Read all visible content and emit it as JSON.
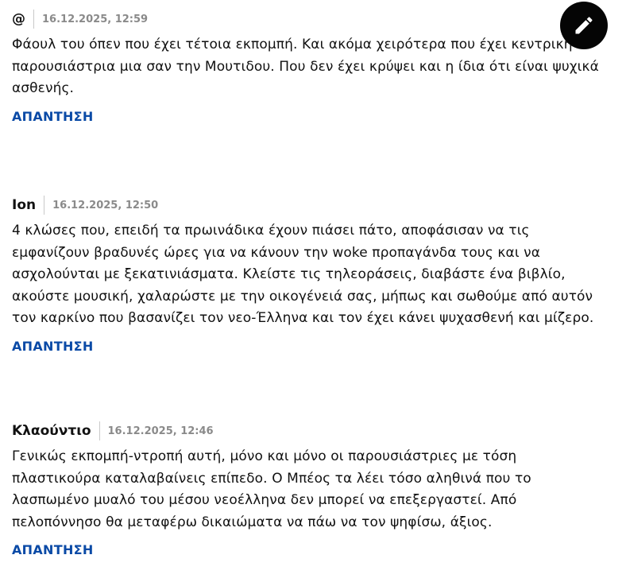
{
  "comments": [
    {
      "author": "@",
      "date": "16.12.2025, 12:59",
      "text": "Φάουλ του όπεν που έχει τέτοια εκπομπή. Και ακόμα χειρότερα που έχει κεντρική παρουσιάστρια μια σαν την Μουτιδου. Που δεν έχει κρύψει και η ίδια ότι είναι ψυχικά ασθενής.",
      "reply_label": "ΑΠΑΝΤΗΣΗ"
    },
    {
      "author": "Ion",
      "date": "16.12.2025, 12:50",
      "text": "4 κλώσες που, επειδή τα πρωινάδικα έχουν πιάσει πάτο, αποφάσισαν να τις εμφανίζουν βραδυνές ώρες για να κάνουν την woke προπαγάνδα τους και να ασχολούνται με ξεκατινιάσματα. Κλείστε τις τηλεοράσεις, διαβάστε ένα βιβλίο, ακούστε μουσική, χαλαρώστε με την οικογένειά σας, μήπως και σωθούμε από αυτόν τον καρκίνο που βασανίζει τον νεο-Έλληνα και τον έχει κάνει ψυχασθενή και μίζερο.",
      "reply_label": "ΑΠΑΝΤΗΣΗ"
    },
    {
      "author": "Κλαούντιο",
      "date": "16.12.2025, 12:46",
      "text": "Γενικώς εκπομπή-ντροπή αυτή, μόνο και μόνο οι παρουσιάστριες με τόση πλαστικούρα καταλαβαίνεις επίπεδο. Ο Μπέος τα λέει τόσο αληθινά που το λασπωμένο μυαλό του μέσου νεοέλληνα δεν μπορεί να επεξεργαστεί. Από πελοπόννησο θα μεταφέρω δικαιώματα να πάω να τον ψηφίσω, άξιος.",
      "reply_label": "ΑΠΑΝΤΗΣΗ"
    }
  ],
  "fab": {
    "icon": "pencil-icon"
  },
  "colors": {
    "reply_link": "#0a4aa6",
    "date_text": "#8a8a8a",
    "fab_background": "#050505"
  }
}
